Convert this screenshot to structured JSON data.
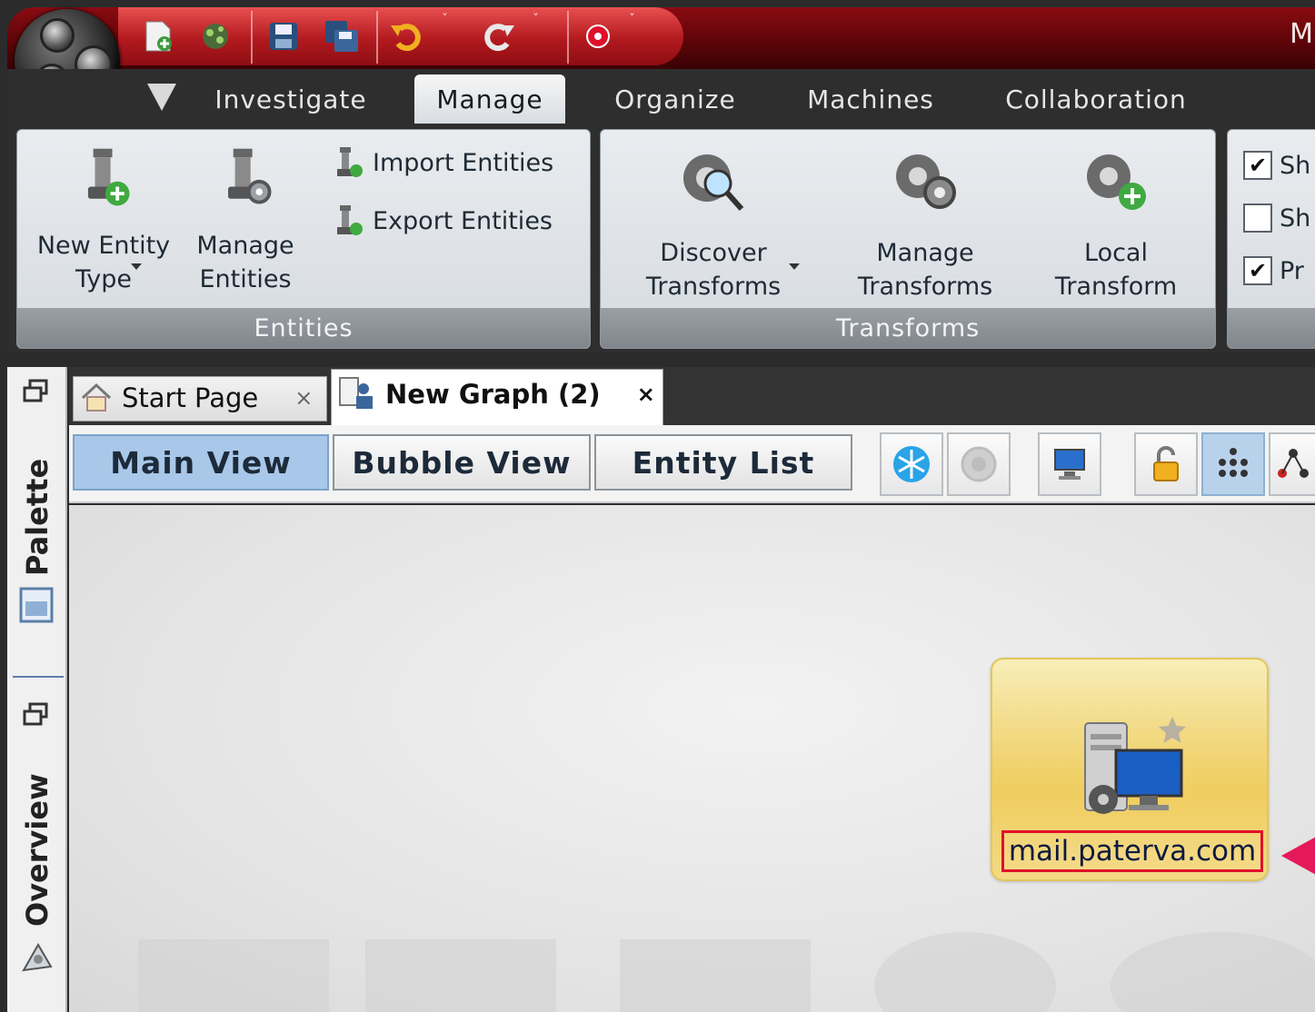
{
  "window": {
    "title": "M"
  },
  "quick_access": {
    "icons": [
      "new-graph-icon",
      "open-graph-icon",
      "save-icon",
      "save-all-icon",
      "undo-icon",
      "redo-icon",
      "options-icon"
    ]
  },
  "menu": {
    "tabs": [
      {
        "label": "Investigate"
      },
      {
        "label": "Manage",
        "active": true
      },
      {
        "label": "Organize"
      },
      {
        "label": "Machines"
      },
      {
        "label": "Collaboration"
      }
    ]
  },
  "ribbon": {
    "entities_group": {
      "title": "Entities",
      "new_entity_type": "New Entity\nType",
      "manage_entities": "Manage\nEntities",
      "import_entities": "Import Entities",
      "export_entities": "Export Entities"
    },
    "transforms_group": {
      "title": "Transforms",
      "discover_transforms": "Discover\nTransforms",
      "manage_transforms": "Manage\nTransforms",
      "local_transform": "Local\nTransform"
    },
    "options_group": {
      "items": [
        {
          "label": "Sh",
          "checked": true
        },
        {
          "label": "Sh",
          "checked": false
        },
        {
          "label": "Pr",
          "checked": true
        }
      ]
    }
  },
  "sidebar": {
    "palette": "Palette",
    "overview": "Overview"
  },
  "doc_tabs": [
    {
      "label": "Start Page",
      "close": "×"
    },
    {
      "label": "New Graph (2)",
      "close": "×",
      "active": true
    }
  ],
  "view_bar": {
    "main_view": "Main View",
    "bubble_view": "Bubble View",
    "entity_list": "Entity List"
  },
  "graph": {
    "entity": {
      "label": "mail.paterva.com",
      "icon": "mx-record-server-icon"
    }
  },
  "colors": {
    "accent": "#e0102a",
    "title_bar": "#7a0a10",
    "active_view": "#a9c8e9"
  }
}
